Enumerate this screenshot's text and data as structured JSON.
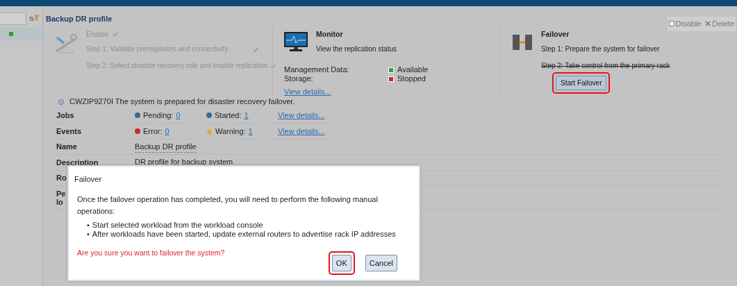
{
  "page": {
    "title": "Backup DR profile"
  },
  "actions": [
    {
      "kind": "disable",
      "label": "Disable"
    },
    {
      "kind": "delete",
      "label": "Delete"
    }
  ],
  "panels": [
    {
      "kind": "enable",
      "dimmed": true,
      "title": "Enable",
      "done": true,
      "steps": [
        {
          "text": "Step 1: Validate prerequisites and connectivity",
          "done": true
        },
        {
          "text": "Step 2: Select disaster recovery role and enable replication",
          "done": true
        }
      ]
    },
    {
      "kind": "monitor",
      "dimmed": false,
      "title": "Monitor",
      "subtitle": "View the replication status",
      "statuses": [
        {
          "label": "Management Data:",
          "value": "Available",
          "color": "#3a9a3a"
        },
        {
          "label": "Storage:",
          "value": "Stopped",
          "color": "#c0282a"
        }
      ],
      "link": "View details..."
    },
    {
      "kind": "failover",
      "dimmed": false,
      "title": "Failover",
      "steps": [
        {
          "text": "Step 1: Prepare the system for failover",
          "struck": false
        },
        {
          "text": "Step 2: Take control from the primary rack",
          "struck": true
        }
      ],
      "button": {
        "label": "Start Failover",
        "highlighted": true
      }
    }
  ],
  "message": "CWZIP9270I The system is prepared for disaster recovery failover.",
  "properties": [
    {
      "kind": "counts",
      "label": "Jobs",
      "items": [
        {
          "kind": "pending",
          "label": "Pending:",
          "count": "0"
        },
        {
          "kind": "started",
          "label": "Started:",
          "count": "1"
        }
      ],
      "link": "View details..."
    },
    {
      "kind": "counts",
      "label": "Events",
      "items": [
        {
          "kind": "error",
          "label": "Error:",
          "count": "0"
        },
        {
          "kind": "warning",
          "label": "Warning:",
          "count": "1"
        }
      ],
      "link": "View details..."
    },
    {
      "kind": "text",
      "label": "Name",
      "value": "Backup DR profile"
    },
    {
      "kind": "text",
      "label": "Description",
      "value": "DR profile for backup system"
    },
    {
      "kind": "label",
      "label_lines": [
        "Ro"
      ]
    },
    {
      "kind": "label",
      "label_lines": [
        "Pe",
        "lo"
      ]
    }
  ],
  "dialog": {
    "title": "Failover",
    "intro": "Once the failover operation has completed, you will need to perform the following manual operations:",
    "bullets": [
      {
        "marker": "•",
        "text": "Start selected workload from the workload console"
      },
      {
        "marker": "•",
        "text": "After workloads have been started, update external routers to advertise rack IP addresses"
      }
    ],
    "warning": "Are you sure you want to failover the system?",
    "buttons": [
      {
        "label": "OK",
        "highlighted": true
      },
      {
        "label": "Cancel",
        "highlighted": false
      }
    ]
  }
}
